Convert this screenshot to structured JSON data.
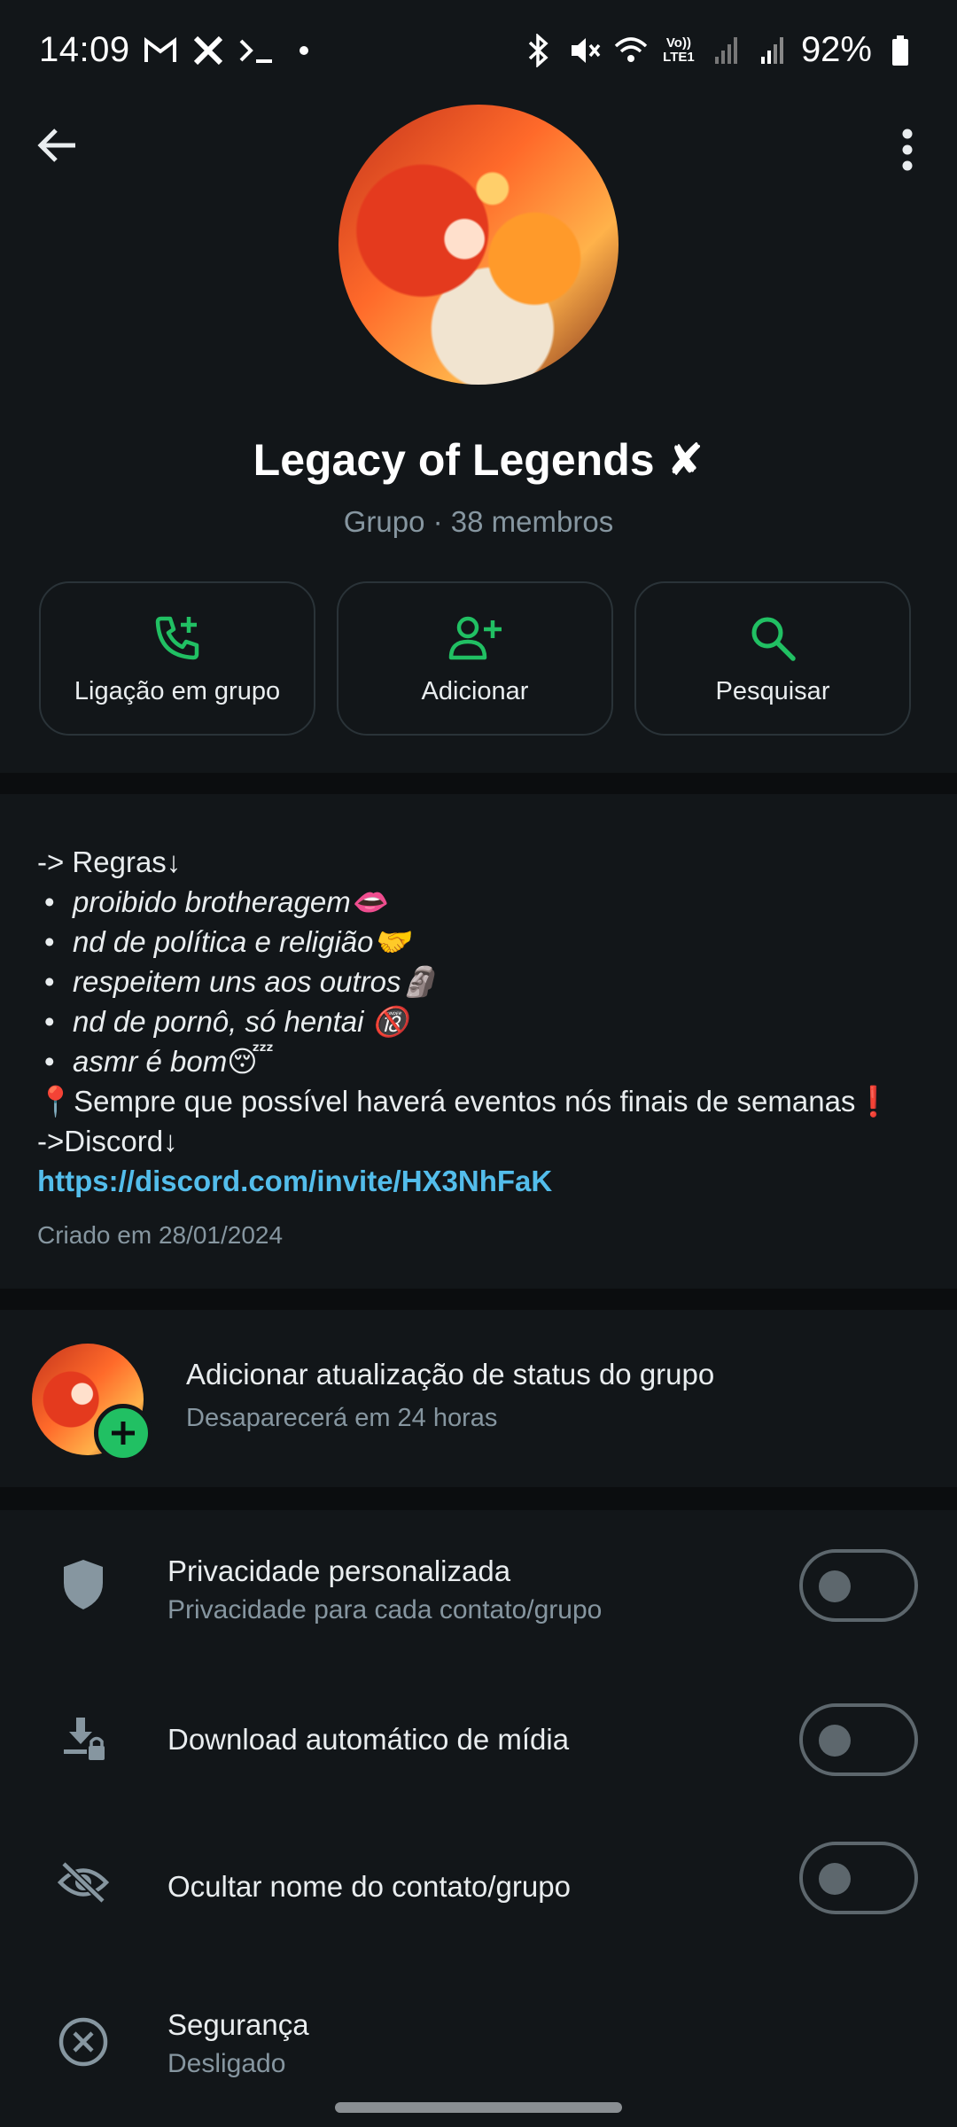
{
  "status_bar": {
    "time": "14:09",
    "left_icons": [
      "gmail-icon",
      "x-icon",
      "terminal-icon",
      "dot-icon"
    ],
    "right_icons": [
      "bluetooth-icon",
      "mute-icon",
      "wifi-icon",
      "volte-icon",
      "signal-icon",
      "signal-icon"
    ],
    "volte_label": "Vo)) LTE1",
    "battery": "92%"
  },
  "header": {
    "group_name": "Legacy of Legends ✘",
    "subtitle": "Grupo · 38 membros"
  },
  "actions": [
    {
      "label": "Ligação em grupo",
      "icon": "add-call-icon"
    },
    {
      "label": "Adicionar",
      "icon": "add-person-icon"
    },
    {
      "label": "Pesquisar",
      "icon": "search-icon"
    }
  ],
  "description": {
    "lines": [
      {
        "kind": "text",
        "text": "-> Regras↓"
      },
      {
        "kind": "bullet",
        "text": "proibido brotheragem👄"
      },
      {
        "kind": "bullet",
        "text": "nd de política e religião🤝"
      },
      {
        "kind": "bullet",
        "text": "respeitem uns aos outros🗿"
      },
      {
        "kind": "bullet",
        "text": "nd de pornô, só hentai 🔞"
      },
      {
        "kind": "bullet",
        "text": "asmr é bom😴"
      },
      {
        "kind": "text",
        "text": "📍Sempre que possível haverá eventos nós finais de semanas❗"
      },
      {
        "kind": "text",
        "text": "->Discord↓"
      }
    ],
    "link": "https://discord.com/invite/HX3NhFaK",
    "created": "Criado em 28/01/2024"
  },
  "status_update": {
    "title": "Adicionar atualização de status do grupo",
    "subtitle": "Desaparecerá em 24 horas"
  },
  "settings": [
    {
      "title": "Privacidade personalizada",
      "subtitle": "Privacidade para cada contato/grupo",
      "icon": "shield-icon",
      "toggle_on": false
    },
    {
      "title": "Download automático de mídia",
      "subtitle": "",
      "icon": "download-lock-icon",
      "toggle_on": false
    },
    {
      "title": "Ocultar nome do contato/grupo",
      "subtitle": "",
      "icon": "eye-off-icon",
      "toggle_on": false
    },
    {
      "title": "Segurança",
      "subtitle": "Desligado",
      "icon": "close-circle-icon"
    }
  ],
  "colors": {
    "accent_green": "#21c063",
    "link_blue": "#53bdeb",
    "background": "#121619",
    "divider": "#0b0d0f"
  }
}
